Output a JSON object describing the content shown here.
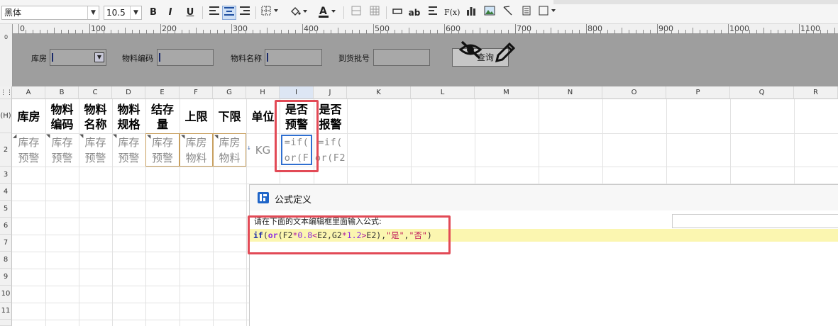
{
  "toolbar": {
    "font_name": "黑体",
    "font_size": "10.5",
    "bold": "B",
    "italic": "I",
    "underline": "U",
    "text_ab": "ab",
    "formula_fx": "F(x)"
  },
  "ruler": {
    "labels": [
      "0",
      "100",
      "200",
      "300",
      "400",
      "500",
      "600",
      "700",
      "800",
      "900",
      "1000",
      "1100"
    ]
  },
  "query": {
    "warehouse_label": "库房",
    "material_code_label": "物料编码",
    "material_name_label": "物料名称",
    "batch_label": "到货批号",
    "query_button": "查询"
  },
  "grid": {
    "columns": [
      "A",
      "B",
      "C",
      "D",
      "E",
      "F",
      "G",
      "H",
      "I",
      "J",
      "K",
      "L",
      "M",
      "N",
      "O",
      "P",
      "Q",
      "R"
    ],
    "header_row_label": "(H)",
    "rows": [
      "2",
      "3",
      "4",
      "5",
      "6",
      "7",
      "8",
      "9",
      "10",
      "11"
    ],
    "headers": [
      "库房",
      "物料\n编码",
      "物料\n名称",
      "物料\n规格",
      "结存\n量",
      "上限",
      "下限",
      "单位",
      "是否\n预警",
      "是否\n报警"
    ],
    "row2": [
      "库存\n预警",
      "库存\n预警",
      "库存\n预警",
      "库存\n预警",
      "库存\n预警",
      "库房\n物料",
      "库房\n物料",
      "KG",
      "=if(\nor(F",
      "=if(\nor(F2"
    ]
  },
  "dialog": {
    "title": "公式定义",
    "prompt": "请在下面的文本编辑框里面输入公式:",
    "formula": {
      "if": "if",
      "open1": "(",
      "or": "or",
      "open2": "(",
      "f2": "F2",
      "mul1": "*",
      "n1": "0.8",
      "lt": "<",
      "e2a": "E2",
      "comma1": ",",
      "g2": "G2",
      "mul2": "*",
      "n2": "1.2",
      "gt": ">",
      "e2b": "E2",
      "close1": ")",
      "comma2": ",",
      "yes": "\"是\"",
      "comma3": ",",
      "no": "\"否\"",
      "close2": ")"
    }
  },
  "colors": {
    "highlight": "#e24a56",
    "selected_cell": "#2f6fd0",
    "formula_bg": "#fbf6b0"
  }
}
